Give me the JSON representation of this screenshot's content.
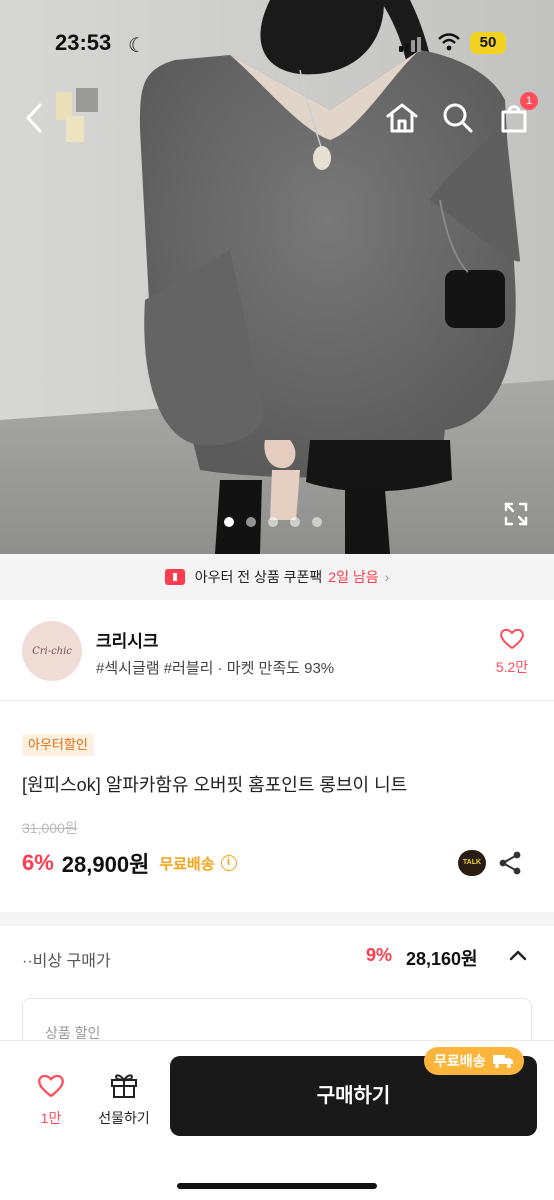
{
  "status": {
    "time": "23:53",
    "battery": "50"
  },
  "header": {
    "cart_count": "1"
  },
  "gallery": {
    "dot_count": 5,
    "active_dot": 0
  },
  "coupon": {
    "text": "아우터 전 상품 쿠폰팩",
    "highlight": "2일 남음"
  },
  "shop": {
    "logo_text": "Cri-chic",
    "name": "크리시크",
    "tags": "#섹시글램 #러블리 · 마켓 만족도 93%",
    "fav_count": "5.2만"
  },
  "product": {
    "badge": "아우터할인",
    "title": "[원피스ok] 알파카함유 오버핏 홈포인트 롱브이 니트",
    "original_price": "31,000원",
    "discount": "6%",
    "price": "28,900원",
    "shipping": "무료배송",
    "talk_label": "TALK"
  },
  "offer": {
    "label": "··비상 구매가",
    "discount": "9%",
    "price": "28,160원"
  },
  "discount_box": {
    "title": "상품 할인"
  },
  "bottom_bar": {
    "like_count": "1만",
    "gift_label": "선물하기",
    "buy_label": "구매하기",
    "free_ship_tag": "무료배송"
  },
  "colors": {
    "accent": "#ff3b4e",
    "orange": "#f2a41c",
    "buy_button": "#191919"
  }
}
